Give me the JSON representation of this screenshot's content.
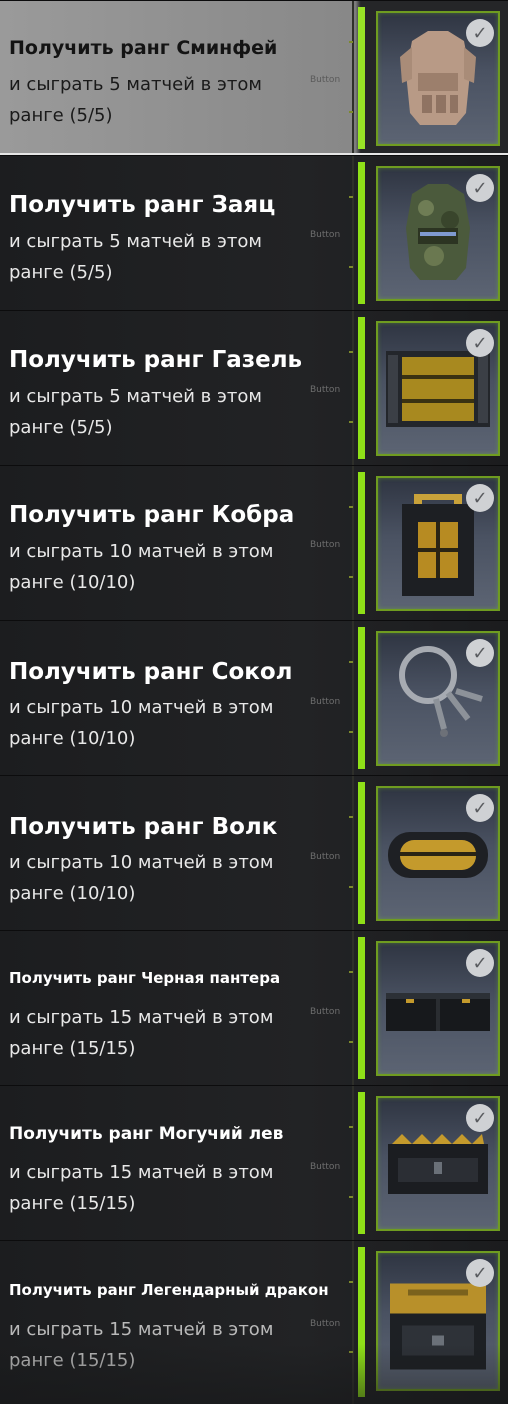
{
  "button_tag": "Button",
  "accent_color": "#8fe018",
  "missions": [
    {
      "title": "Получить ранг Сминфей",
      "desc": "и сыграть 5 матчей в этом ранге (5/5)",
      "reward_icon": "body-armor-vest-tan-icon",
      "completed": true
    },
    {
      "title": "Получить ранг Заяц",
      "desc": "и сыграть 5 матчей в этом ранге (5/5)",
      "reward_icon": "body-armor-vest-camo-icon",
      "completed": true
    },
    {
      "title": "Получить ранг Газель",
      "desc": "и сыграть 5 матчей в этом ранге (5/5)",
      "reward_icon": "yellow-crate-icon",
      "completed": true
    },
    {
      "title": "Получить ранг Кобра",
      "desc": "и сыграть 10 матчей в этом ранге (10/10)",
      "reward_icon": "gold-case-icon",
      "completed": true
    },
    {
      "title": "Получить ранг Сокол",
      "desc": "и сыграть 10 матчей в этом ранге (10/10)",
      "reward_icon": "key-ring-icon",
      "completed": true
    },
    {
      "title": "Получить ранг Волк",
      "desc": "и сыграть 10 матчей в этом ранге (10/10)",
      "reward_icon": "gold-capsule-case-icon",
      "completed": true
    },
    {
      "title": "Получить ранг Черная пантера",
      "desc": "и сыграть 15 матчей в этом ранге (15/15)",
      "reward_icon": "long-black-case-icon",
      "completed": true
    },
    {
      "title": "Получить ранг Могучий лев",
      "desc": "и сыграть 15 матчей в этом ранге (15/15)",
      "reward_icon": "striped-chest-icon",
      "completed": true
    },
    {
      "title": "Получить ранг Легендарный дракон",
      "desc": "и сыграть 15 матчей в этом ранге (15/15)",
      "reward_icon": "legendary-crate-icon",
      "completed": true
    }
  ]
}
